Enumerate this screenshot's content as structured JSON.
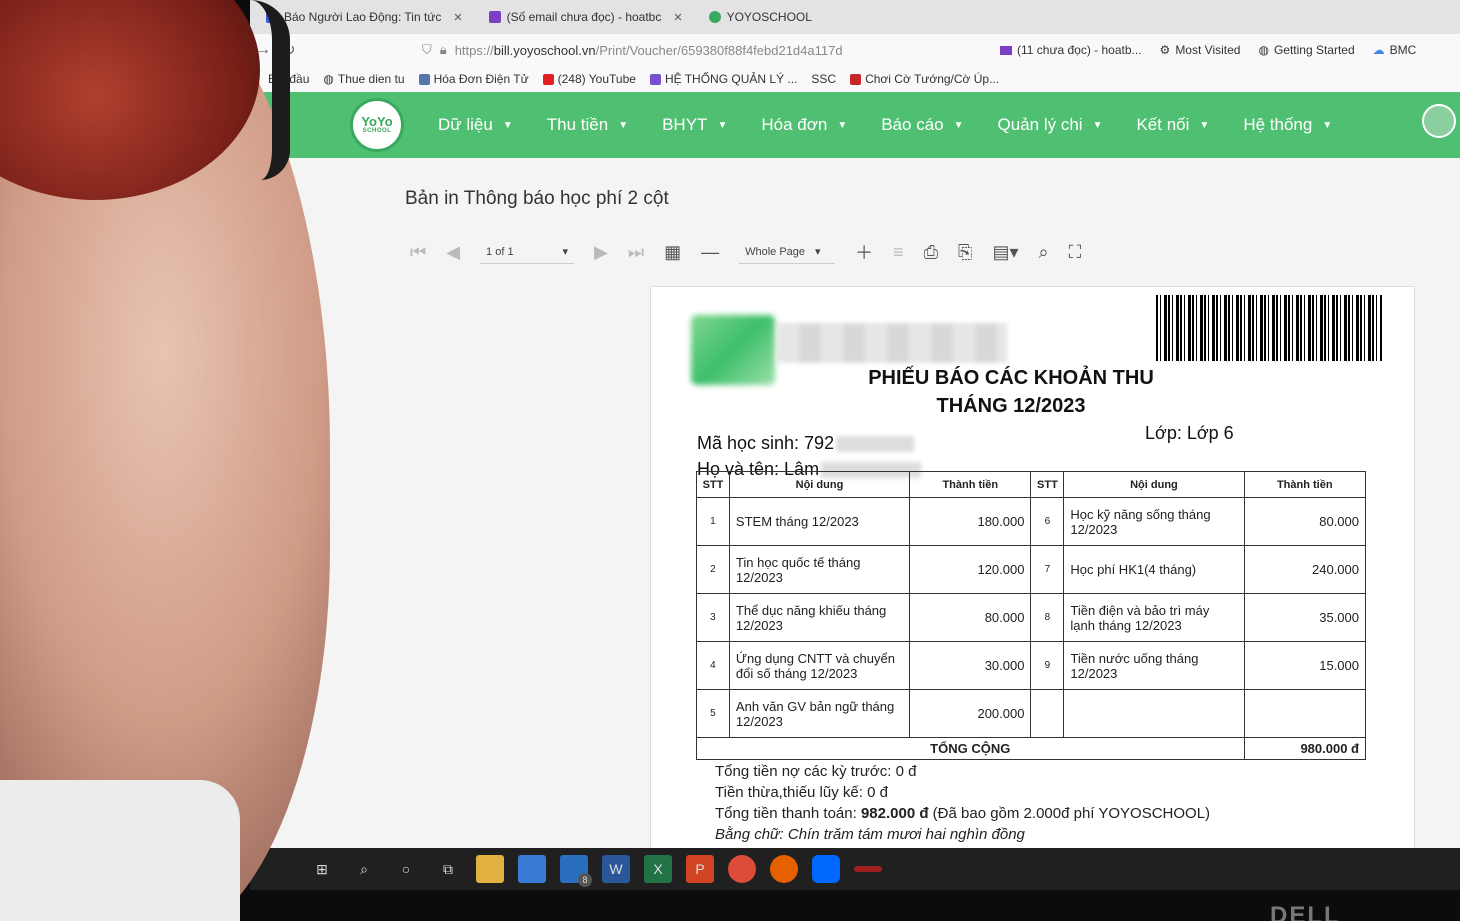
{
  "browser": {
    "tabs": [
      {
        "label": "Báo Người Lao Động: Tin tức",
        "color": "#3b5bdb"
      },
      {
        "label": "(Số email chưa đọc) - hoatbc",
        "color": "#7b3fc4"
      },
      {
        "label": "YOYOSCHOOL",
        "color": "#3aa95e"
      }
    ],
    "url_prefix": "https://",
    "url_domain": "bill.yoyoschool.vn",
    "url_path": "/Print/Voucher/659380f88f4febd21d4a117d",
    "quick_links": [
      "(11 chưa đọc) - hoatb...",
      "Most Visited",
      "Getting Started",
      "BMC"
    ],
    "bookmarks": [
      "Bắt đầu",
      "Thue dien tu",
      "Hóa Đơn Điện Tử",
      "(248) YouTube",
      "HỆ THỐNG QUẢN LÝ ...",
      "SSC",
      "Chơi Cờ Tướng/Cờ Úp..."
    ]
  },
  "app": {
    "logo_top": "YoYo",
    "logo_bottom": "SCHOOL",
    "menu": [
      "Dữ liệu",
      "Thu tiền",
      "BHYT",
      "Hóa đơn",
      "Báo cáo",
      "Quản lý chi",
      "Kết nối",
      "Hệ thống"
    ],
    "accent": "#4fc071"
  },
  "viewer": {
    "heading": "Bản in Thông báo học phí 2 cột",
    "page_indicator": "1 of 1",
    "zoom": "Whole Page"
  },
  "report": {
    "title_line1": "PHIẾU BÁO CÁC KHOẢN THU",
    "title_line2": "THÁNG 12/2023",
    "student_id_label": "Mã học sinh: 792",
    "class_label": "Lớp: Lớp 6",
    "name_label": "Họ và tên: Lâm",
    "headers": [
      "STT",
      "Nội dung",
      "Thành tiền",
      "STT",
      "Nội dung",
      "Thành tiền"
    ],
    "rows": [
      {
        "n1": "1",
        "c1": "STEM tháng 12/2023",
        "v1": "180.000",
        "n2": "6",
        "c2": "Học kỹ năng sống tháng 12/2023",
        "v2": "80.000"
      },
      {
        "n1": "2",
        "c1": "Tin học quốc tế tháng 12/2023",
        "v1": "120.000",
        "n2": "7",
        "c2": "Học phí HK1(4 tháng)",
        "v2": "240.000"
      },
      {
        "n1": "3",
        "c1": "Thể dục năng khiếu tháng 12/2023",
        "v1": "80.000",
        "n2": "8",
        "c2": "Tiền điện và bảo trì máy lạnh tháng 12/2023",
        "v2": "35.000"
      },
      {
        "n1": "4",
        "c1": "Ứng dụng CNTT và chuyển đổi số tháng 12/2023",
        "v1": "30.000",
        "n2": "9",
        "c2": "Tiền nước uống tháng 12/2023",
        "v2": "15.000"
      },
      {
        "n1": "5",
        "c1": "Anh văn GV bản ngữ tháng 12/2023",
        "v1": "200.000",
        "n2": "",
        "c2": "",
        "v2": ""
      }
    ],
    "total_label": "TỔNG CỘNG",
    "total_value": "980.000 đ",
    "debt_line": "Tổng tiền nợ các kỳ trước: 0 đ",
    "balance_line": "Tiền thừa,thiếu lũy kế: 0 đ",
    "pay_label": "Tổng tiền thanh toán: ",
    "pay_value": "982.000 đ",
    "pay_note": " (Đã bao gồm 2.000đ phí YOYOSCHOOL)",
    "in_words": "Bằng chữ: Chín trăm tám mươi hai nghìn đồng"
  },
  "taskbar": {
    "mail_badge": "8"
  },
  "bezel_brand": "DELL"
}
